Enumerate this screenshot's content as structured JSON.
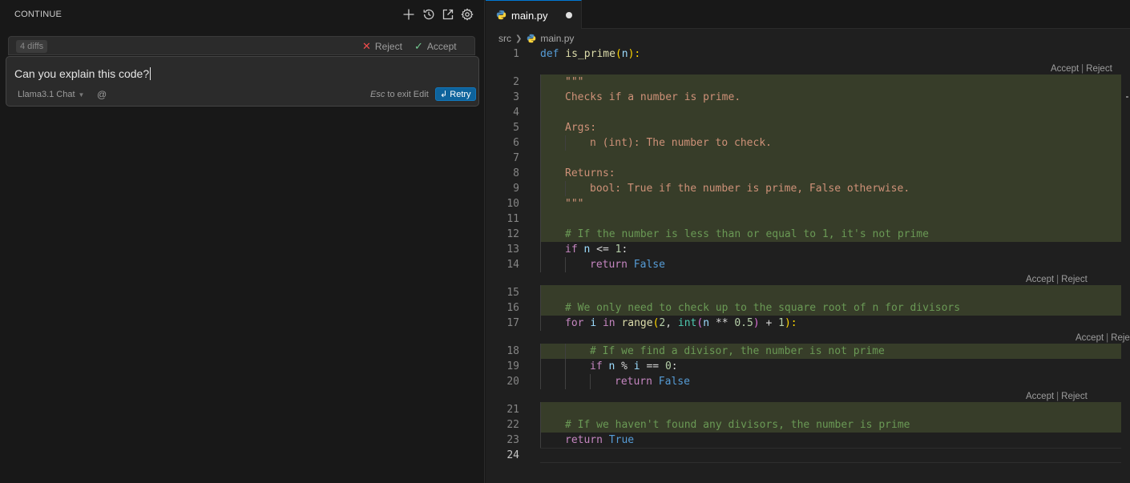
{
  "panel": {
    "title": "CONTINUE",
    "icons": [
      "plus-icon",
      "history-icon",
      "open-in-new-icon",
      "gear-icon"
    ]
  },
  "diff_bar": {
    "count_label": "4 diffs",
    "reject_label": "Reject",
    "accept_label": "Accept"
  },
  "input": {
    "text": "Can you explain this code?",
    "model_label": "Llama3.1 Chat",
    "at_label": "@",
    "esc_key": "Esc",
    "esc_text": "to exit Edit",
    "retry_label": "Retry",
    "retry_icon": "↲"
  },
  "editor": {
    "tab_label": "main.py",
    "tab_modified": true,
    "breadcrumb": [
      "src",
      "main.py"
    ],
    "hunk_accept": "Accept",
    "hunk_reject": "Reject",
    "line_numbers": [
      "1",
      "2",
      "3",
      "4",
      "5",
      "6",
      "7",
      "8",
      "9",
      "10",
      "11",
      "12",
      "13",
      "14",
      "15",
      "16",
      "17",
      "18",
      "19",
      "20",
      "21",
      "22",
      "23",
      "24"
    ],
    "lines": {
      "l1": {
        "a": "def",
        "b": " ",
        "c": "is_prime",
        "d": "(",
        "e": "n",
        "f": "):"
      },
      "l2": "\"\"\"",
      "l3": "Checks if a number is prime.",
      "l5": "Args:",
      "l6": "n (int): The number to check.",
      "l8": "Returns:",
      "l9": "bool: True if the number is prime, False otherwise.",
      "l10": "\"\"\"",
      "l12": "# If the number is less than or equal to 1, it's not prime",
      "l13": {
        "a": "if",
        "b": " ",
        "c": "n",
        "d": " <= ",
        "e": "1",
        "f": ":"
      },
      "l14": {
        "a": "return",
        "b": " ",
        "c": "False"
      },
      "l16": "# We only need to check up to the square root of n for divisors",
      "l17": {
        "a": "for",
        "b": " ",
        "c": "i",
        "d": " ",
        "e": "in",
        "f": " ",
        "g": "range",
        "h": "(",
        "i": "2",
        "j": ", ",
        "k": "int",
        "l": "(",
        "m": "n",
        "n": " ** ",
        "o": "0.5",
        "p": ")",
        "q": " + ",
        "r": "1",
        "s": "):"
      },
      "l18": "# If we find a divisor, the number is not prime",
      "l19": {
        "a": "if",
        "b": " ",
        "c": "n",
        "d": " % ",
        "e": "i",
        "f": " == ",
        "g": "0",
        "h": ":"
      },
      "l20": {
        "a": "return",
        "b": " ",
        "c": "False"
      },
      "l22": "# If we haven't found any divisors, the number is prime",
      "l23": {
        "a": "return",
        "b": " ",
        "c": "True"
      }
    },
    "colors": {
      "added_background": "#373d29",
      "accent": "#0078d4",
      "retry_button": "#0e639c"
    }
  }
}
